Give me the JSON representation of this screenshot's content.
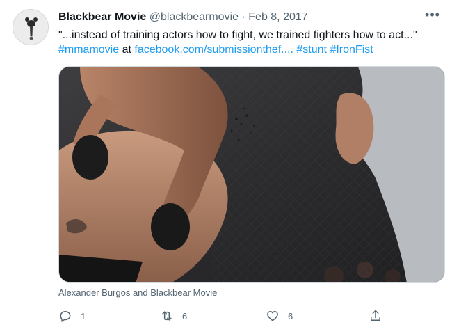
{
  "tweet": {
    "author_name": "Blackbear Movie",
    "handle": "@blackbearmovie",
    "separator": "·",
    "date": "Feb 8, 2017",
    "more_label": "•••",
    "text_quote": "\"...instead of training actors how to fight, we trained fighters how to act...\"",
    "hashtag_1": "#mmamovie",
    "text_at": "at",
    "link_text": "facebook.com/submissionthef....",
    "hashtag_2": "#stunt",
    "hashtag_3": "#IronFist",
    "media_caption": "Alexander Burgos and Blackbear Movie",
    "reply_count": "1",
    "retweet_count": "6",
    "like_count": "6"
  },
  "colors": {
    "link": "#1d9bf0",
    "secondary_text": "#536471",
    "primary_text": "#0f1419"
  },
  "icons": {
    "avatar": "bear-avatar",
    "reply": "reply-icon",
    "retweet": "retweet-icon",
    "like": "heart-icon",
    "share": "share-icon"
  }
}
